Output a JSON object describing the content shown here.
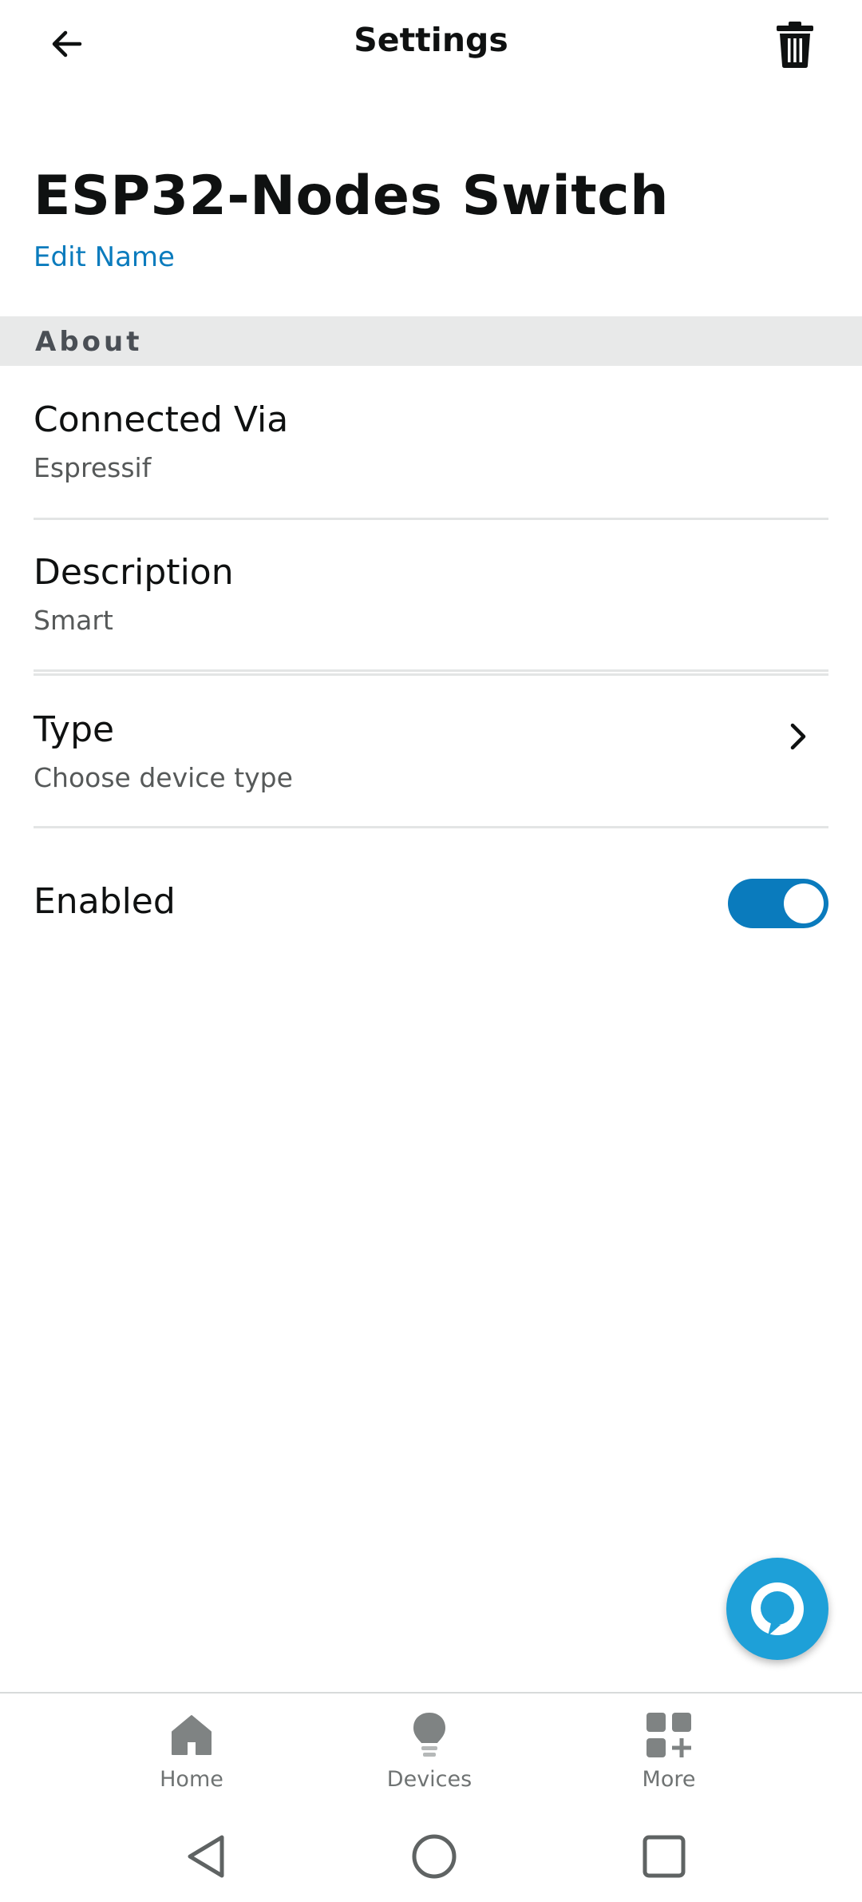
{
  "appbar": {
    "title": "Settings"
  },
  "device": {
    "name": "ESP32-Nodes Switch",
    "edit_label": "Edit Name"
  },
  "about": {
    "header": "About",
    "connected_via": {
      "title": "Connected Via",
      "value": "Espressif"
    },
    "description": {
      "title": "Description",
      "value": "Smart"
    },
    "type": {
      "title": "Type",
      "value": "Choose device type"
    },
    "enabled": {
      "title": "Enabled",
      "on": true
    }
  },
  "colors": {
    "accent": "#0a7bbd",
    "alexa": "#1ea0d8",
    "section_bg": "#e8e9e9"
  },
  "bottom_nav": {
    "items": [
      {
        "label": "Home",
        "icon": "home-icon"
      },
      {
        "label": "Devices",
        "icon": "bulb-icon"
      },
      {
        "label": "More",
        "icon": "more-grid-icon"
      }
    ]
  }
}
